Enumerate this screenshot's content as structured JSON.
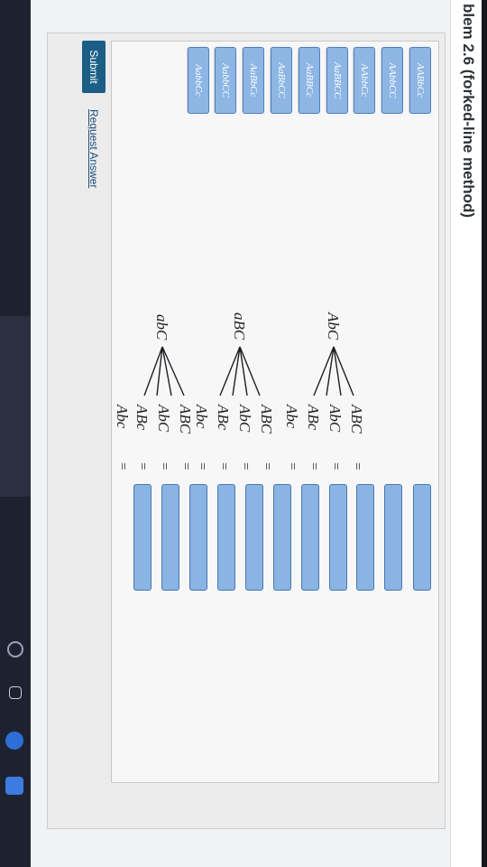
{
  "problem": {
    "title": "blem 2.6 (forked-line method)"
  },
  "answer_options": [
    {
      "label": "AABbCc"
    },
    {
      "label": "AAbbCC"
    },
    {
      "label": "AAbbCc"
    },
    {
      "label": "AaBBCC"
    },
    {
      "label": "AaBBCc"
    },
    {
      "label": "AaBbCC"
    },
    {
      "label": "AaBbCc"
    },
    {
      "label": "AabbCC"
    },
    {
      "label": "AabbCc"
    }
  ],
  "forked_line": {
    "parents": [
      {
        "label": "AbC"
      },
      {
        "label": "aBC"
      },
      {
        "label": "abC"
      }
    ],
    "rows": [
      {
        "gametes": "ABC",
        "equals": "="
      },
      {
        "gametes": "AbC",
        "equals": "="
      },
      {
        "gametes": "ABc",
        "equals": "="
      },
      {
        "gametes": "Abc",
        "equals": "="
      },
      {
        "gametes": "ABC",
        "equals": "="
      },
      {
        "gametes": "AbC",
        "equals": "="
      },
      {
        "gametes": "ABc",
        "equals": "="
      },
      {
        "gametes": "Abc",
        "equals": "="
      },
      {
        "gametes": "ABC",
        "equals": "="
      },
      {
        "gametes": "AbC",
        "equals": "="
      },
      {
        "gametes": "ABc",
        "equals": "="
      },
      {
        "gametes": "Abc",
        "equals": "="
      }
    ]
  },
  "actions": {
    "submit": "Submit",
    "request_answer": "Request Answer"
  },
  "colors": {
    "accent": "#1b5f86",
    "option_fill": "#8eb6e4",
    "link": "#1c4f7a"
  }
}
